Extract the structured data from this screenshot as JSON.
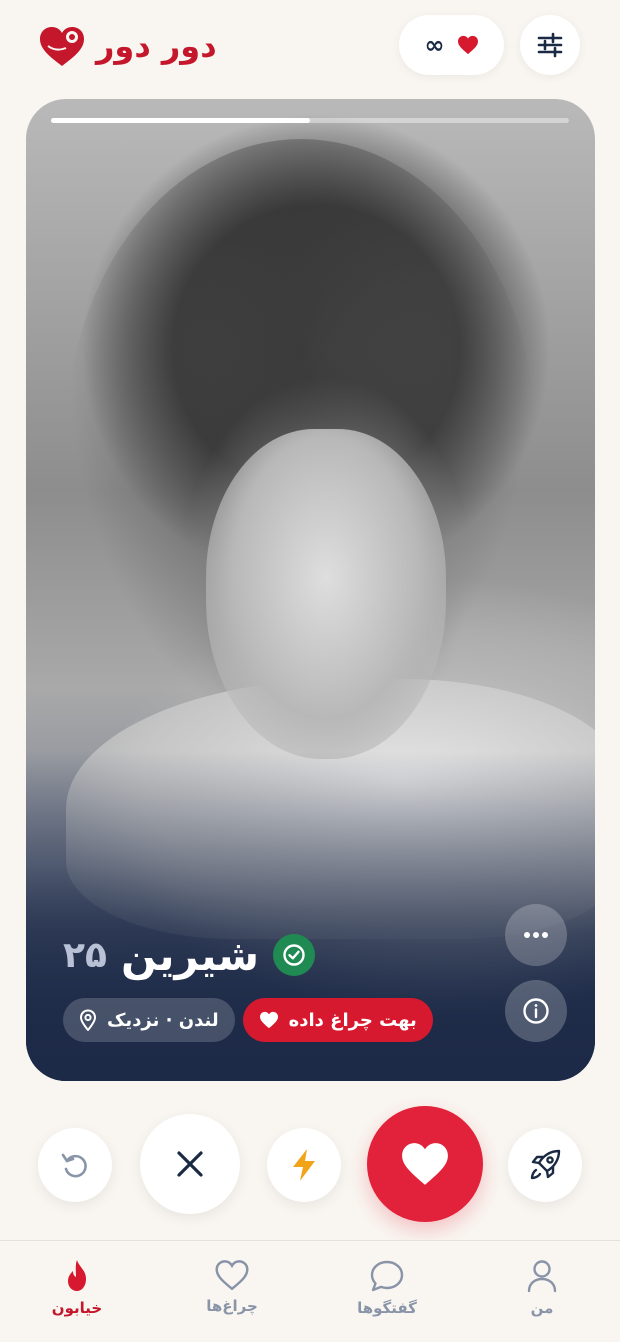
{
  "header": {
    "brand_name": "دور دور",
    "likes_count": "∞"
  },
  "profile": {
    "name": "شیرین",
    "age": "۲۵",
    "location": "لندن · نزدیک",
    "liked_you_label": "بهت چراغ داده",
    "photo_progress": 0.5
  },
  "nav": {
    "explore": "خیابون",
    "likes": "چراغ‌ها",
    "chats": "گفتگوها",
    "me": "من"
  },
  "colors": {
    "accent": "#e2223b",
    "brand": "#c4172c",
    "verified": "#1f8a52",
    "boost": "#f2a419"
  },
  "icons": {
    "filter": "sliders-icon",
    "heart": "heart-icon",
    "more": "more-dots-icon",
    "info": "info-icon",
    "undo": "undo-icon",
    "nope": "close-icon",
    "boost": "lightning-icon",
    "super": "rocket-icon"
  }
}
